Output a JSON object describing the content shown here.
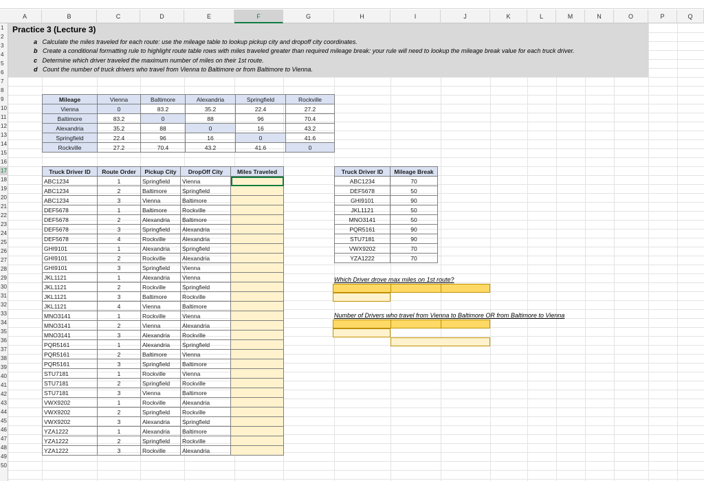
{
  "column_headers": [
    "A",
    "B",
    "C",
    "D",
    "E",
    "F",
    "G",
    "H",
    "I",
    "J",
    "K",
    "L",
    "M",
    "N",
    "O",
    "P",
    "Q"
  ],
  "row_headers": [
    "1",
    "2",
    "3",
    "4",
    "5",
    "6",
    "7",
    "8",
    "9",
    "10",
    "11",
    "12",
    "13",
    "14",
    "15",
    "16",
    "17",
    "18",
    "19",
    "20",
    "21",
    "22",
    "23",
    "24",
    "25",
    "26",
    "27",
    "28",
    "29",
    "30",
    "31",
    "32",
    "33",
    "34",
    "35",
    "36",
    "37",
    "38",
    "39",
    "40",
    "41",
    "42",
    "43",
    "44",
    "45",
    "46",
    "47",
    "48",
    "49",
    "50"
  ],
  "selected_column": "F",
  "selected_row": "17",
  "title": "Practice 3 (Lecture 3)",
  "instructions": [
    {
      "letter": "a",
      "text": "Calculate the miles traveled for each route: use the mileage table to lookup pickup city and dropoff city coordinates."
    },
    {
      "letter": "b",
      "text": "Create a conditional formatting rule to highlight route table rows with miles traveled greater than required mileage break: your rule will need to lookup the mileage break value for each truck driver."
    },
    {
      "letter": "c",
      "text": "Determine which driver traveled the maximum number of miles on their 1st route."
    },
    {
      "letter": "d",
      "text": "Count the number of truck drivers who travel from Vienna to Baltimore or from Baltimore to Vienna."
    }
  ],
  "mileage_table": {
    "corner": "Mileage",
    "cities": [
      "Vienna",
      "Baltimore",
      "Alexandria",
      "Springfield",
      "Rockville"
    ],
    "values": [
      [
        "0",
        "83.2",
        "35.2",
        "22.4",
        "27.2"
      ],
      [
        "83.2",
        "0",
        "88",
        "96",
        "70.4"
      ],
      [
        "35.2",
        "88",
        "0",
        "16",
        "43.2"
      ],
      [
        "22.4",
        "96",
        "16",
        "0",
        "41.6"
      ],
      [
        "27.2",
        "70.4",
        "43.2",
        "41.6",
        "0"
      ]
    ]
  },
  "route_table": {
    "headers": [
      "Truck Driver ID",
      "Route Order",
      "Pickup City",
      "DropOff City",
      "Miles Traveled"
    ],
    "rows": [
      [
        "ABC1234",
        "1",
        "Springfield",
        "Vienna"
      ],
      [
        "ABC1234",
        "2",
        "Baltimore",
        "Springfield"
      ],
      [
        "ABC1234",
        "3",
        "Vienna",
        "Baltimore"
      ],
      [
        "DEF5678",
        "1",
        "Baltimore",
        "Rockville"
      ],
      [
        "DEF5678",
        "2",
        "Alexandria",
        "Baltimore"
      ],
      [
        "DEF5678",
        "3",
        "Springfield",
        "Alexandria"
      ],
      [
        "DEF5678",
        "4",
        "Rockville",
        "Alexandria"
      ],
      [
        "GHI9101",
        "1",
        "Alexandria",
        "Springfield"
      ],
      [
        "GHI9101",
        "2",
        "Rockville",
        "Alexandria"
      ],
      [
        "GHI9101",
        "3",
        "Springfield",
        "Vienna"
      ],
      [
        "JKL1121",
        "1",
        "Alexandria",
        "Vienna"
      ],
      [
        "JKL1121",
        "2",
        "Rockville",
        "Springfield"
      ],
      [
        "JKL1121",
        "3",
        "Baltimore",
        "Rockville"
      ],
      [
        "JKL1121",
        "4",
        "Vienna",
        "Baltimore"
      ],
      [
        "MNO3141",
        "1",
        "Rockville",
        "Vienna"
      ],
      [
        "MNO3141",
        "2",
        "Vienna",
        "Alexandria"
      ],
      [
        "MNO3141",
        "3",
        "Alexandria",
        "Rockville"
      ],
      [
        "PQR5161",
        "1",
        "Alexandria",
        "Springfield"
      ],
      [
        "PQR5161",
        "2",
        "Baltimore",
        "Vienna"
      ],
      [
        "PQR5161",
        "3",
        "Springfield",
        "Baltimore"
      ],
      [
        "STU7181",
        "1",
        "Rockville",
        "Vienna"
      ],
      [
        "STU7181",
        "2",
        "Springfield",
        "Rockville"
      ],
      [
        "STU7181",
        "3",
        "Vienna",
        "Baltimore"
      ],
      [
        "VWX9202",
        "1",
        "Rockville",
        "Alexandria"
      ],
      [
        "VWX9202",
        "2",
        "Springfield",
        "Rockville"
      ],
      [
        "VWX9202",
        "3",
        "Alexandria",
        "Springfield"
      ],
      [
        "YZA1222",
        "1",
        "Alexandria",
        "Baltimore"
      ],
      [
        "YZA1222",
        "2",
        "Springfield",
        "Rockville"
      ],
      [
        "YZA1222",
        "3",
        "Rockville",
        "Alexandria"
      ]
    ]
  },
  "mileage_break_table": {
    "headers": [
      "Truck Driver ID",
      "Mileage Break"
    ],
    "rows": [
      [
        "ABC1234",
        "70"
      ],
      [
        "DEF5678",
        "50"
      ],
      [
        "GHI9101",
        "90"
      ],
      [
        "JKL1121",
        "50"
      ],
      [
        "MNO3141",
        "50"
      ],
      [
        "PQR5161",
        "90"
      ],
      [
        "STU7181",
        "90"
      ],
      [
        "VWX9202",
        "70"
      ],
      [
        "YZA1222",
        "70"
      ]
    ]
  },
  "questions": {
    "max_miles": "Which Driver drove max miles on 1st route?",
    "count_drivers": "Number of Drivers who travel from Vienna to Baltimore OR from Baltimore to Vienna"
  },
  "colors": {
    "header_fill": "#d9e1f2",
    "answer_fill": "#ffd966",
    "miles_fill": "#fff2cc",
    "selection": "#107c41",
    "title_band": "#d9d9d9"
  }
}
